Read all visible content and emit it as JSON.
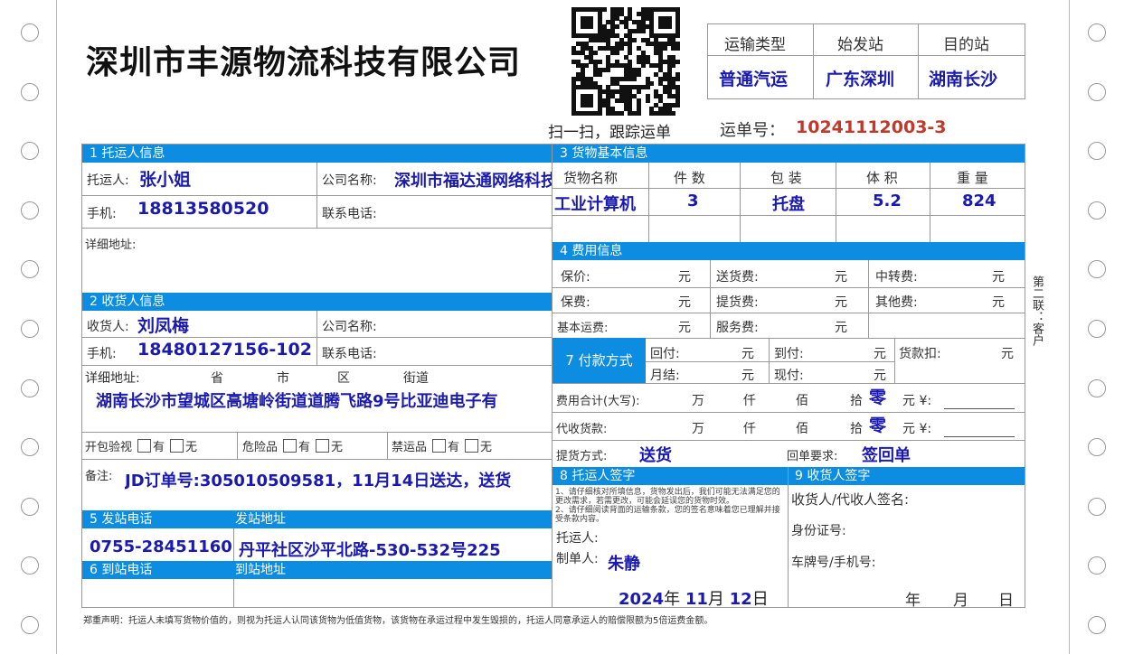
{
  "company": "深圳市丰源物流科技有限公司",
  "qr": {
    "caption": "扫一扫，跟踪运单"
  },
  "route": {
    "headers": [
      "运输类型",
      "始发站",
      "目的站"
    ],
    "values": [
      "普通汽运",
      "广东深圳",
      "湖南长沙"
    ]
  },
  "waybill": {
    "label": "运单号：",
    "number": "10241112003-3"
  },
  "shipper": {
    "section": "1 托运人信息",
    "name_label": "托运人:",
    "name": "张小姐",
    "company_label": "公司名称:",
    "company": "深圳市福达通网络科技",
    "mobile_label": "手机:",
    "mobile": "18813580520",
    "phone_label": "联系电话:",
    "address_label": "详细地址:"
  },
  "consignee": {
    "section": "2 收货人信息",
    "name_label": "收货人:",
    "name": "刘凤梅",
    "company_label": "公司名称:",
    "mobile_label": "手机:",
    "mobile": "18480127156-102",
    "phone_label": "联系电话:",
    "address_label": "详细地址:",
    "addr_parts": [
      "省",
      "市",
      "区",
      "街道"
    ],
    "address": "湖南长沙市望城区高塘岭街道道腾飞路9号比亚迪电子有"
  },
  "checks": {
    "open": "开包验视",
    "danger": "危险品",
    "forbidden": "禁运品",
    "yes": "有",
    "no": "无"
  },
  "remark": {
    "label": "备注:",
    "text": "JD订单号:305010509581，11月14日送达，送货"
  },
  "origin": {
    "section_phone": "5 发站电话",
    "section_addr": "发站地址",
    "phone": "0755-28451160",
    "address": "丹平社区沙平北路-530-532号225"
  },
  "destination": {
    "section_phone": "6 到站电话",
    "section_addr": "到站地址"
  },
  "goods": {
    "section": "3 货物基本信息",
    "headers": [
      "货物名称",
      "件 数",
      "包 装",
      "体 积",
      "重 量"
    ],
    "row": [
      "工业计算机",
      "3",
      "托盘",
      "5.2",
      "824"
    ]
  },
  "fees": {
    "section": "4 费用信息",
    "unit": "元",
    "rows": [
      [
        "保价:",
        "送货费:",
        "中转费:"
      ],
      [
        "保费:",
        "提货费:",
        "其他费:"
      ],
      [
        "基本运费:",
        "服务费:"
      ]
    ]
  },
  "payment": {
    "label": "7 付款方式",
    "items": [
      "回付:",
      "到付:",
      "货款扣:",
      "月结:",
      "现付:"
    ],
    "total_label": "费用合计(大写):",
    "cod_label": "代收货款:",
    "units": [
      "万",
      "仟",
      "佰",
      "拾"
    ],
    "zero": "零",
    "yuan": "元 ¥:",
    "pickup_label": "提货方式:",
    "pickup": "送货",
    "return_label": "回单要求:",
    "return": "签回单"
  },
  "sign_shipper": {
    "section": "8 托运人签字",
    "notes": [
      "1、请仔细核对所填信息，货物发出后，我们可能无法满足您的更改需求，若需更改，可能会延误您的货物时效。",
      "2、请仔细阅读背面的运输条款，您的签名意味着您已理解并接受条款内容。"
    ],
    "shipper_label": "托运人:",
    "maker_label": "制单人:",
    "maker": "朱静",
    "year": "2024",
    "month": "11",
    "day": "12",
    "nian": "年",
    "yue": "月",
    "ri": "日"
  },
  "sign_consignee": {
    "section": "9 收货人签字",
    "sign_label": "收货人/代收人签名:",
    "id_label": "身份证号:",
    "plate_label": "车牌号/手机号:",
    "nian": "年",
    "yue": "月",
    "ri": "日"
  },
  "copy_label": "第二联：客户",
  "footer": "郑重声明：托运人未填写货物价值的，则视为托运人认同该货物为低值货物，该货物在承运过程中发生毁损的，托运人同意承运人的赔偿限额为5倍运费金额。"
}
